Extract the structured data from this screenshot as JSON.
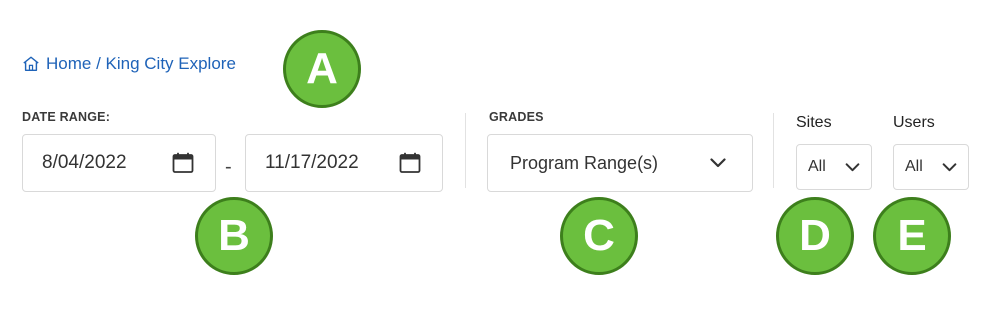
{
  "breadcrumb": {
    "icon": "home-icon",
    "text": "Home / King City Explore"
  },
  "date_range": {
    "label": "DATE RANGE:",
    "start": "8/04/2022",
    "separator": "-",
    "end": "11/17/2022",
    "icon": "calendar-icon"
  },
  "grades": {
    "label": "GRADES",
    "selected": "Program Range(s)"
  },
  "sites": {
    "label": "Sites",
    "selected": "All"
  },
  "users": {
    "label": "Users",
    "selected": "All"
  },
  "callouts": {
    "a": "A",
    "b": "B",
    "c": "C",
    "d": "D",
    "e": "E",
    "color": "#6bbf3e",
    "border_color": "#3d7f1c"
  },
  "colors": {
    "link": "#1f63b8",
    "border": "#d9d9d9"
  }
}
